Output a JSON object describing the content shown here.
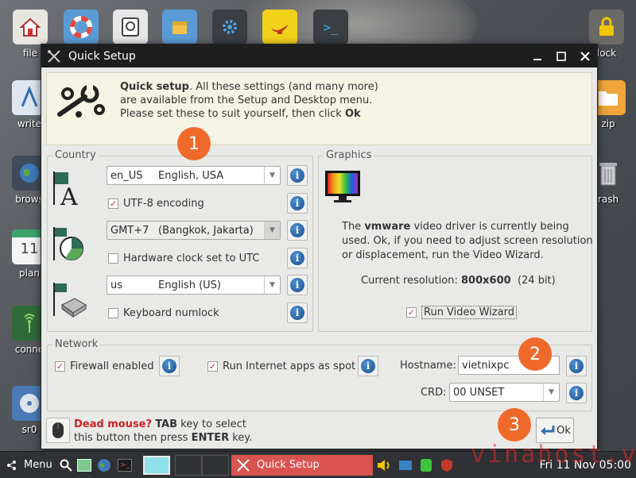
{
  "desktop": {
    "icons_left": [
      {
        "label": "file"
      },
      {
        "label": "write"
      },
      {
        "label": "brows"
      },
      {
        "label": "plan",
        "calendar_day": "11"
      },
      {
        "label": "conne"
      },
      {
        "label": "sr0"
      }
    ],
    "icons_right": [
      {
        "label": "lock"
      },
      {
        "label": "zip"
      },
      {
        "label": "rash"
      }
    ]
  },
  "window": {
    "title": "Quick Setup",
    "intro": {
      "bold": "Quick setup",
      "text": ". All these settings (and many more) are available from the Setup and Desktop menu. Please set these to suit yourself, then click ",
      "ok": "Ok"
    },
    "country": {
      "legend": "Country",
      "locale_code": "en_US",
      "locale_name": "English, USA",
      "utf8_label": "UTF-8 encoding",
      "utf8_checked": true,
      "tz_code": "GMT+7",
      "tz_name": "(Bangkok, Jakarta)",
      "hwclock_label": "Hardware clock set to UTC",
      "hwclock_checked": false,
      "kb_code": "us",
      "kb_name": "English (US)",
      "numlock_label": "Keyboard numlock",
      "numlock_checked": false
    },
    "graphics": {
      "legend": "Graphics",
      "text_pre": "The ",
      "driver": "vmware",
      "text_post": " video driver is currently being used. Ok, if you need to adjust screen resolution or displacement, run the Video Wizard.",
      "res_label": "Current resolution: ",
      "res_value": "800x600",
      "res_bits": "  (24 bit)",
      "wizard_label": "Run Video Wizard",
      "wizard_checked": true
    },
    "network": {
      "legend": "Network",
      "firewall_label": "Firewall enabled",
      "firewall_checked": true,
      "runspot_label": "Run Internet apps as spot",
      "runspot_checked": true,
      "hostname_label": "Hostname:",
      "hostname_value": "vietnixpc",
      "crd_label": "CRD:",
      "crd_value": "00 UNSET"
    },
    "footer": {
      "dead_mouse": "Dead mouse?",
      "tab_key": "TAB",
      "line1_rest": " key to select",
      "line2_pre": "this button then press ",
      "enter_key": "ENTER",
      "line2_post": " key.",
      "ok_label": "Ok"
    },
    "badges": [
      "1",
      "2",
      "3"
    ]
  },
  "taskbar": {
    "menu_label": "Menu",
    "active_task": "Quick Setup",
    "clock": "Fri 11 Nov 05:00"
  },
  "watermark": "vinahost.vn",
  "colors": {
    "badge": "#ef6a2a",
    "check_mark": "#c8322f",
    "active_task": "#d9534f",
    "dead_mouse": "#cc2222"
  }
}
